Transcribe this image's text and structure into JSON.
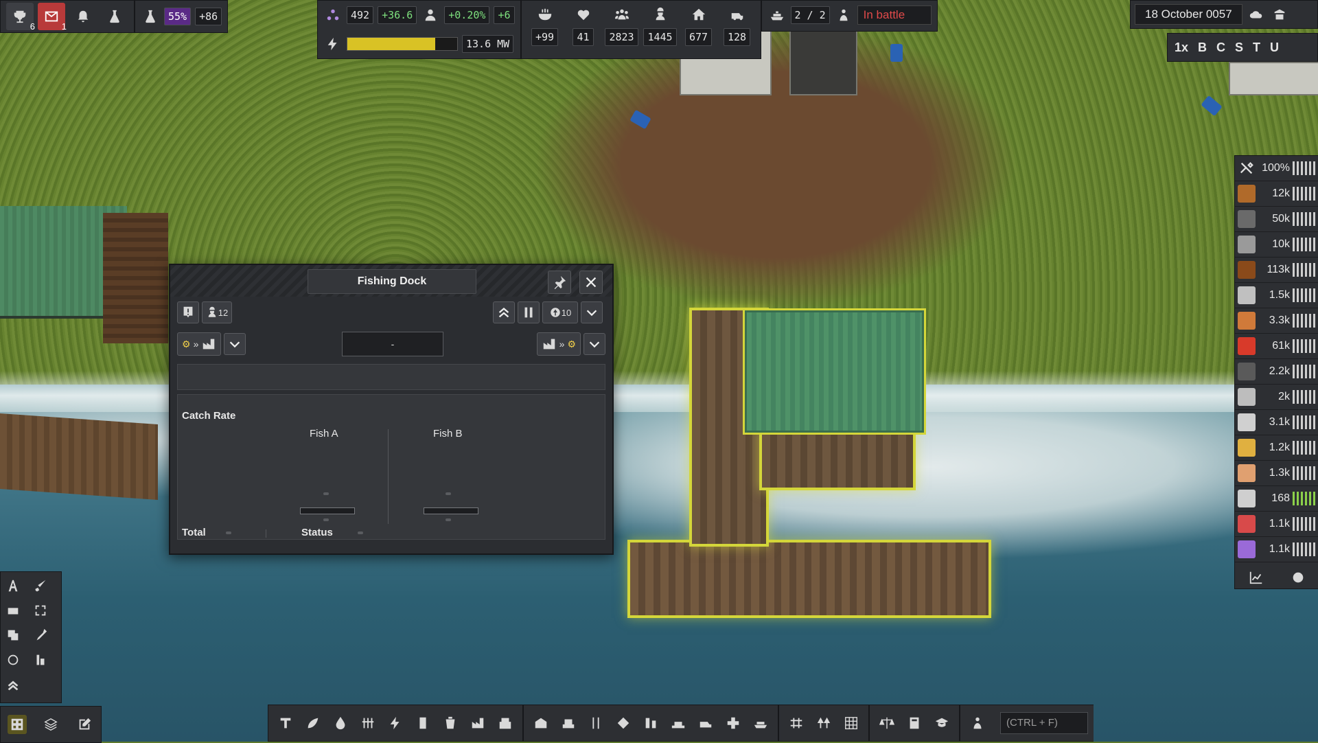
{
  "top_left": {
    "achievements_count": "6",
    "messages_count": "1",
    "research_percent": "55%",
    "research_rate": "+86"
  },
  "top_center": {
    "unity_value": "492",
    "unity_rate": "+36.6",
    "population_growth": "+0.20%",
    "population_change": "+6",
    "power_value": "13.6 MW",
    "power_fill": 0.8,
    "stats": [
      {
        "icon": "food-icon",
        "value": "+99"
      },
      {
        "icon": "health-icon",
        "value": "41"
      },
      {
        "icon": "population-icon",
        "value": "2823"
      },
      {
        "icon": "workers-icon",
        "value": "1445"
      },
      {
        "icon": "housing-icon",
        "value": "677"
      },
      {
        "icon": "vehicles-icon",
        "value": "128"
      }
    ],
    "ships_value": "2 / 2",
    "battle_status": "In battle"
  },
  "top_right": {
    "date": "18 October 0057",
    "speed": "1x",
    "speed_letters": [
      "B",
      "C",
      "S",
      "T",
      "U"
    ]
  },
  "resources": {
    "maintenance": "100%",
    "items": [
      {
        "value": "12k",
        "color": "#b06a2a",
        "green": false
      },
      {
        "value": "50k",
        "color": "#6a6a6a",
        "green": false
      },
      {
        "value": "10k",
        "color": "#9a9a9a",
        "green": false
      },
      {
        "value": "113k",
        "color": "#8a4a1a",
        "green": false
      },
      {
        "value": "1.5k",
        "color": "#c0c0c0",
        "green": false
      },
      {
        "value": "3.3k",
        "color": "#d07a3a",
        "green": false
      },
      {
        "value": "61k",
        "color": "#d83a2a",
        "green": false
      },
      {
        "value": "2.2k",
        "color": "#5a5a5a",
        "green": false
      },
      {
        "value": "2k",
        "color": "#bdbdbd",
        "green": false
      },
      {
        "value": "3.1k",
        "color": "#d0d0d0",
        "green": false
      },
      {
        "value": "1.2k",
        "color": "#e0b040",
        "green": false
      },
      {
        "value": "1.3k",
        "color": "#e0a070",
        "green": false
      },
      {
        "value": "168",
        "color": "#cfcfcf",
        "green": true
      },
      {
        "value": "1.1k",
        "color": "#d84a4a",
        "green": false
      },
      {
        "value": "1.1k",
        "color": "#9a6ad8",
        "green": false
      }
    ]
  },
  "window": {
    "title": "Fishing Dock",
    "workers_count": "12",
    "priority_value": "10",
    "center_field": "-",
    "catch_rate_label": "Catch Rate",
    "fish_a": "Fish A",
    "fish_b": "Fish B",
    "total_label": "Total",
    "status_label": "Status"
  },
  "search": {
    "placeholder": "(CTRL + F)"
  }
}
